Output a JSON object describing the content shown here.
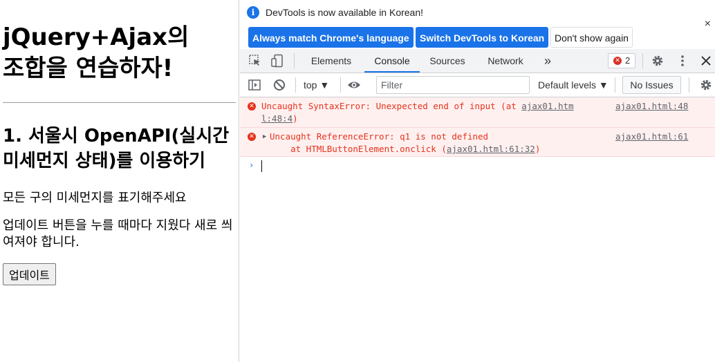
{
  "page": {
    "title": "jQuery+Ajax의 조합을 연습하자!",
    "section_heading": "1. 서울시 OpenAPI(실시간 미세먼지 상태)를 이용하기",
    "description_1": "모든 구의 미세먼지를 표기해주세요",
    "description_2": "업데이트 버튼을 누를 때마다 지웠다 새로 씌여져야 합니다.",
    "update_button": "업데이트"
  },
  "infobar": {
    "icon": "info-icon",
    "message": "DevTools is now available in Korean!",
    "btn_match": "Always match Chrome's language",
    "btn_switch": "Switch DevTools to Korean",
    "btn_dismiss": "Don't show again",
    "close": "×"
  },
  "tabs": {
    "elements": "Elements",
    "console": "Console",
    "sources": "Sources",
    "network": "Network",
    "more": "»",
    "error_count": "2"
  },
  "toolbar": {
    "context": "top ▼",
    "filter_placeholder": "Filter",
    "levels": "Default levels ▼",
    "issues": "No Issues"
  },
  "console": {
    "messages": [
      {
        "text_line1": "Uncaught SyntaxError: Unexpected end of input (at ",
        "link_part": "ajax01.htm",
        "text_line2_link": "l:48:4",
        "text_line2_end": ")",
        "source": "ajax01.html:48"
      },
      {
        "expander": "▶",
        "text_line1": "Uncaught ReferenceError: q1 is not defined",
        "text_line2_start": "    at HTMLButtonElement.onclick (",
        "text_line2_link": "ajax01.html:61:32",
        "text_line2_end": ")",
        "source": "ajax01.html:61"
      }
    ],
    "prompt": "›"
  },
  "colors": {
    "accent": "#1a73e8",
    "error": "#e5321a",
    "error_bg": "#fff0f0"
  }
}
